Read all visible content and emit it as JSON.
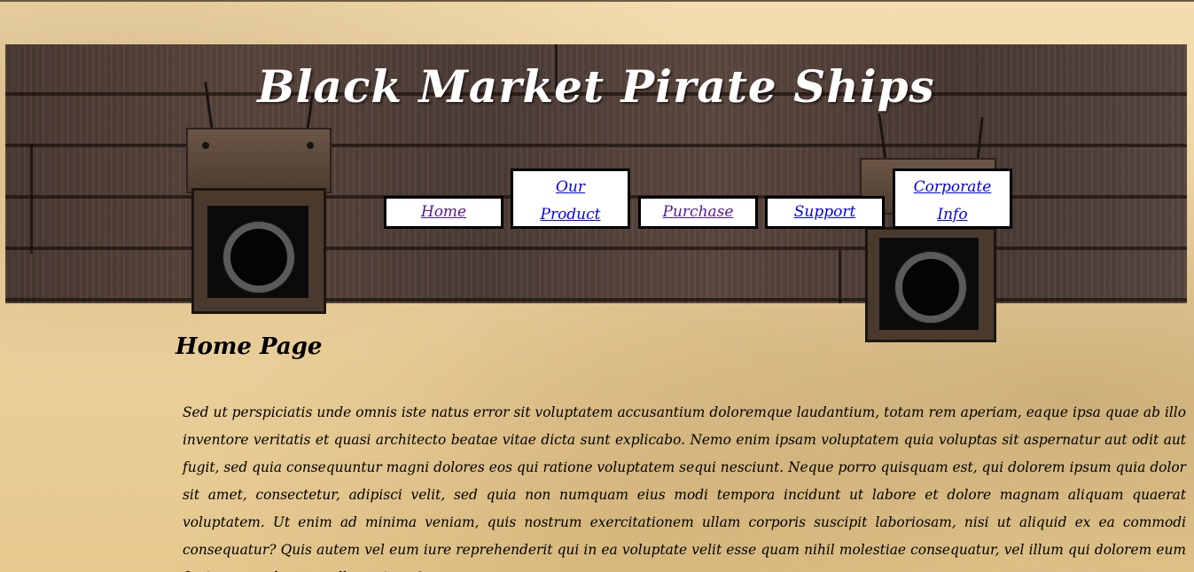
{
  "header": {
    "title": "Black Market Pirate Ships"
  },
  "nav": {
    "items": [
      {
        "label": "Home"
      },
      {
        "label": "Our Product"
      },
      {
        "label": "Purchase"
      },
      {
        "label": "Support"
      },
      {
        "label": "Corporate Info"
      }
    ]
  },
  "main": {
    "heading": "Home Page",
    "paragraph": "Sed ut perspiciatis unde omnis iste natus error sit voluptatem accusantium doloremque laudantium, totam rem aperiam, eaque ipsa quae ab illo inventore veritatis et quasi architecto beatae vitae dicta sunt explicabo. Nemo enim ipsam voluptatem quia voluptas sit aspernatur aut odit aut fugit, sed quia consequuntur magni dolores eos qui ratione voluptatem sequi nesciunt. Neque porro quisquam est, qui dolorem ipsum quia dolor sit amet, consectetur, adipisci velit, sed quia non numquam eius modi tempora incidunt ut labore et dolore magnam aliquam quaerat voluptatem. Ut enim ad minima veniam, quis nostrum exercitationem ullam corporis suscipit laboriosam, nisi ut aliquid ex ea commodi consequatur? Quis autem vel eum iure reprehenderit qui in ea voluptate velit esse quam nihil molestiae consequatur, vel illum qui dolorem eum fugiat quo voluptas nulla pariatur?"
  },
  "colors": {
    "link": "#0000ee",
    "visited_link": "#551a8b",
    "nav_background": "#ffffff",
    "title_text": "#ffffff",
    "parchment": "#ecd29f",
    "wood": "#4d3d37"
  },
  "icons": {
    "left_cannon": "cannon-port-icon",
    "right_cannon": "cannon-port-icon"
  }
}
